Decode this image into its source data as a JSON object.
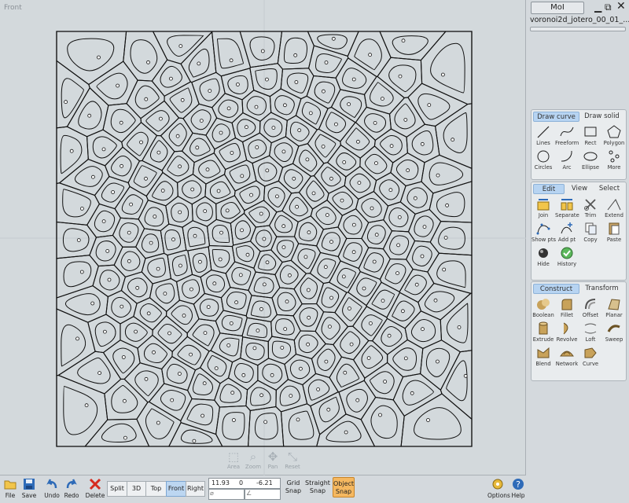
{
  "viewport": {
    "title": "Front"
  },
  "nav_controls": [
    {
      "label": "Area",
      "icon": "area-icon"
    },
    {
      "label": "Zoom",
      "icon": "zoom-icon"
    },
    {
      "label": "Pan",
      "icon": "pan-icon"
    },
    {
      "label": "Reset",
      "icon": "reset-icon"
    }
  ],
  "header": {
    "app_button": "MoI",
    "file_name": "voronoi2d_jotero_00_01_..."
  },
  "draw_panel": {
    "tabs": [
      "Draw curve",
      "Draw solid"
    ],
    "tools": [
      {
        "label": "Lines",
        "icon": "lines-icon"
      },
      {
        "label": "Freeform",
        "icon": "freeform-icon"
      },
      {
        "label": "Rect",
        "icon": "rect-icon"
      },
      {
        "label": "Polygon",
        "icon": "polygon-icon"
      },
      {
        "label": "Circles",
        "icon": "circle-icon"
      },
      {
        "label": "Arc",
        "icon": "arc-icon"
      },
      {
        "label": "Ellipse",
        "icon": "ellipse-icon"
      },
      {
        "label": "More",
        "icon": "more-icon"
      }
    ]
  },
  "edit_panel": {
    "tabs": [
      "Edit",
      "View",
      "Select"
    ],
    "tools": [
      {
        "label": "Join",
        "icon": "join-icon"
      },
      {
        "label": "Separate",
        "icon": "separate-icon"
      },
      {
        "label": "Trim",
        "icon": "trim-icon"
      },
      {
        "label": "Extend",
        "icon": "extend-icon"
      },
      {
        "label": "Show pts",
        "icon": "show-pts-icon"
      },
      {
        "label": "Add pt",
        "icon": "add-pt-icon"
      },
      {
        "label": "Copy",
        "icon": "copy-icon"
      },
      {
        "label": "Paste",
        "icon": "paste-icon"
      },
      {
        "label": "Hide",
        "icon": "hide-icon"
      },
      {
        "label": "History",
        "icon": "history-icon"
      }
    ]
  },
  "construct_panel": {
    "tabs": [
      "Construct",
      "Transform"
    ],
    "tools": [
      {
        "label": "Boolean",
        "icon": "boolean-icon"
      },
      {
        "label": "Fillet",
        "icon": "fillet-icon"
      },
      {
        "label": "Offset",
        "icon": "offset-icon"
      },
      {
        "label": "Planar",
        "icon": "planar-icon"
      },
      {
        "label": "Extrude",
        "icon": "extrude-icon"
      },
      {
        "label": "Revolve",
        "icon": "revolve-icon"
      },
      {
        "label": "Loft",
        "icon": "loft-icon"
      },
      {
        "label": "Sweep",
        "icon": "sweep-icon"
      },
      {
        "label": "Blend",
        "icon": "blend-icon"
      },
      {
        "label": "Network",
        "icon": "network-icon"
      },
      {
        "label": "Curve",
        "icon": "curve-icon"
      }
    ]
  },
  "toolbar": {
    "file": "File",
    "save": "Save",
    "undo": "Undo",
    "redo": "Redo",
    "delete": "Delete",
    "views": [
      "Split",
      "3D",
      "Top",
      "Front",
      "Right"
    ],
    "active_view": "Front",
    "coords": {
      "x": "11.93",
      "y": "0",
      "z": "-6.21"
    },
    "grid_snap": [
      "Grid",
      "Snap"
    ],
    "straight_snap": [
      "Straight",
      "Snap"
    ],
    "object_snap": [
      "Object",
      "Snap"
    ],
    "options": "Options",
    "help": "Help"
  },
  "colors": {
    "accent": "#b7d4f2",
    "object_snap": "#f5b860",
    "viewport_bg": "#d3d9dc"
  }
}
